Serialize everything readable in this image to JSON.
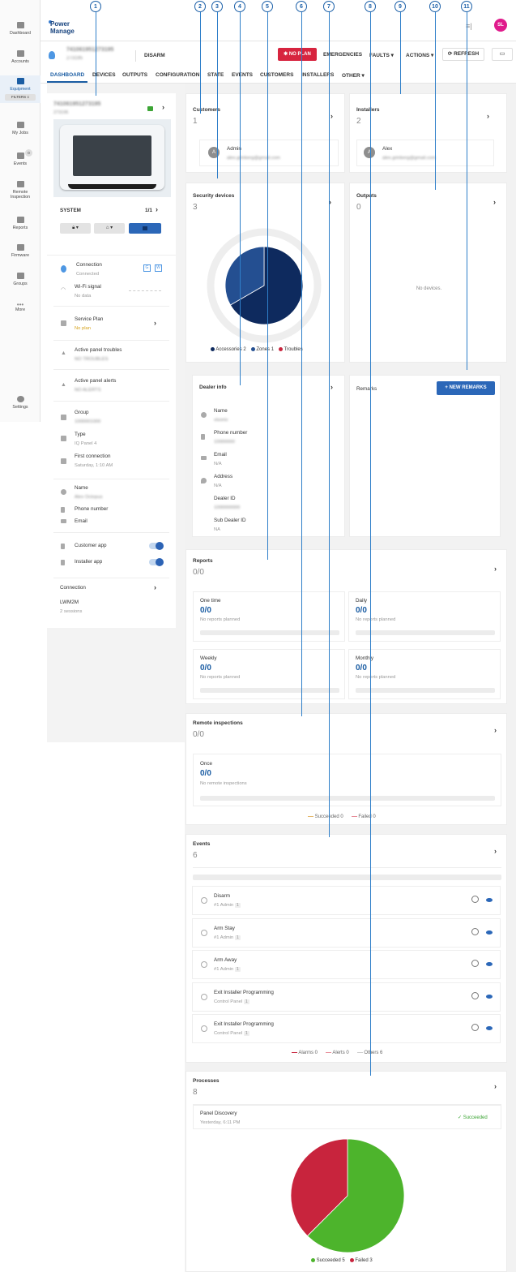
{
  "callouts": [
    "1",
    "2",
    "3",
    "4",
    "5",
    "6",
    "7",
    "8",
    "9",
    "10",
    "11"
  ],
  "sidebar": {
    "items": [
      {
        "label": "Dashboard",
        "icon": "dashboard-icon"
      },
      {
        "label": "Accounts",
        "icon": "accounts-icon"
      },
      {
        "label": "Equipment",
        "icon": "equipment-icon",
        "active": true
      },
      {
        "label": "My Jobs",
        "icon": "jobs-icon"
      },
      {
        "label": "Events",
        "icon": "events-icon",
        "badge": "0"
      },
      {
        "label": "Remote Inspection",
        "icon": "wrench-icon"
      },
      {
        "label": "Reports",
        "icon": "reports-icon"
      },
      {
        "label": "Firmware",
        "icon": "firmware-icon"
      },
      {
        "label": "Groups",
        "icon": "groups-icon"
      },
      {
        "label": "More",
        "icon": "more-icon"
      },
      {
        "label": "Settings",
        "icon": "gear-icon"
      }
    ],
    "filters_label": "FILTERS"
  },
  "brand": {
    "line1": "Power",
    "line2": "Manage"
  },
  "avatar_initials": "SL",
  "header": {
    "panel_id": "741061951273195",
    "panel_sub": "273195",
    "state": "DISARM",
    "buttons": {
      "no_plan": "NO PLAN",
      "emergencies": "EMERGENCIES",
      "faults": "FAULTS",
      "actions": "ACTIONS",
      "refresh": "REFRESH"
    }
  },
  "tabs": [
    "DASHBOARD",
    "DEVICES",
    "OUTPUTS",
    "CONFIGURATION",
    "STATE",
    "EVENTS",
    "CUSTOMERS",
    "INSTALLERS",
    "OTHER"
  ],
  "panel": {
    "id": "741061951273195",
    "sub": "273195",
    "system_label": "SYSTEM",
    "system_count": "1/1",
    "connection": {
      "label": "Connection",
      "value": "Connected",
      "badges": [
        "G",
        "W"
      ]
    },
    "wifi": {
      "label": "Wi-Fi signal",
      "value": "No data"
    },
    "service_plan": {
      "label": "Service Plan",
      "value": "No plan"
    },
    "troubles": {
      "label": "Active panel troubles",
      "value": "NO TROUBLES"
    },
    "alerts": {
      "label": "Active panel alerts",
      "value": "NO ALERTS"
    },
    "group": {
      "label": "Group",
      "value": "1000001000"
    },
    "type": {
      "label": "Type",
      "value": "IQ Panel 4"
    },
    "first_connection": {
      "label": "First connection",
      "value": "Saturday, 1:10 AM"
    },
    "name": {
      "label": "Name",
      "value": "Alex Octopus"
    },
    "phone": {
      "label": "Phone number"
    },
    "email": {
      "label": "Email"
    },
    "customer_app": "Customer app",
    "installer_app": "Installer app",
    "conn2": {
      "label": "Connection",
      "proto": "LWM2M",
      "sessions": "2 sessions"
    }
  },
  "customers": {
    "title": "Customers",
    "count": "1",
    "user": {
      "initial": "A",
      "name": "Admin",
      "email": "alex.grinberg@gmail.com"
    }
  },
  "installers": {
    "title": "Installers",
    "count": "2",
    "user": {
      "initial": "A",
      "name": "Alex",
      "email": "alex.grinberg@gmail.com"
    }
  },
  "security": {
    "title": "Security devices",
    "count": "3"
  },
  "outputs": {
    "title": "Outputs",
    "count": "0",
    "empty": "No devices."
  },
  "chart_data": [
    {
      "type": "pie",
      "series": [
        {
          "name": "Accessories",
          "value": 2,
          "color": "#0e2a5e"
        },
        {
          "name": "Zones",
          "value": 1,
          "color": "#244f91"
        },
        {
          "name": "Troubles",
          "value": 0,
          "color": "#c8243d"
        }
      ],
      "legend": [
        {
          "name": "Accessories 2",
          "color": "#0e2a5e"
        },
        {
          "name": "Zones 1",
          "color": "#244f91"
        },
        {
          "name": "Troubles",
          "color": "#c8243d"
        }
      ]
    },
    {
      "type": "pie",
      "series": [
        {
          "name": "Succeeded",
          "value": 5,
          "color": "#4db42c"
        },
        {
          "name": "Failed",
          "value": 3,
          "color": "#c8243d"
        }
      ],
      "legend": [
        {
          "name": "Succeeded 5",
          "color": "#4db42c"
        },
        {
          "name": "Failed 3",
          "color": "#c8243d"
        }
      ]
    }
  ],
  "dealer": {
    "title": "Dealer info",
    "name": {
      "label": "Name",
      "value": "visonic"
    },
    "phone": {
      "label": "Phone number",
      "value": "10000000"
    },
    "email": {
      "label": "Email",
      "value": "N/A"
    },
    "address": {
      "label": "Address",
      "value": "N/A"
    },
    "dealer_id": {
      "label": "Dealer ID",
      "value": "1000000000"
    },
    "sub_dealer_id": {
      "label": "Sub Dealer ID",
      "value": "NA"
    }
  },
  "remarks": {
    "title": "Remarks",
    "button": "NEW REMARKS"
  },
  "reports": {
    "title": "Reports",
    "count": "0/0",
    "boxes": [
      {
        "label": "One time",
        "value": "0/0",
        "sub": "No reports planned"
      },
      {
        "label": "Daily",
        "value": "0/0",
        "sub": "No reports planned"
      },
      {
        "label": "Weekly",
        "value": "0/0",
        "sub": "No reports planned"
      },
      {
        "label": "Monthly",
        "value": "0/0",
        "sub": "No reports planned"
      }
    ]
  },
  "inspections": {
    "title": "Remote inspections",
    "count": "0/0",
    "once": {
      "label": "Once",
      "value": "0/0",
      "sub": "No remote inspections"
    },
    "legend": [
      {
        "name": "Succeeded 0",
        "color": "#e5b96d"
      },
      {
        "name": "Failed 0",
        "color": "#e78d99"
      }
    ]
  },
  "events": {
    "title": "Events",
    "count": "6",
    "rows": [
      {
        "title": "Disarm",
        "sub": "#1 Admin",
        "tag": "1"
      },
      {
        "title": "Arm Stay",
        "sub": "#1 Admin",
        "tag": "1"
      },
      {
        "title": "Arm Away",
        "sub": "#1 Admin",
        "tag": "1"
      },
      {
        "title": "Exit Installer Programming",
        "sub": "Control Panel",
        "tag": "1"
      },
      {
        "title": "Exit Installer Programming",
        "sub": "Control Panel",
        "tag": "1"
      }
    ],
    "legend": [
      {
        "name": "Alarms 0",
        "color": "#c8243d"
      },
      {
        "name": "Alerts 0",
        "color": "#e78d99"
      },
      {
        "name": "Others 6",
        "color": "#cccccc"
      }
    ]
  },
  "processes": {
    "title": "Processes",
    "count": "8",
    "item": {
      "title": "Panel Discovery",
      "time": "Yesterday, 6:11 PM",
      "status": "Succeeded"
    }
  }
}
